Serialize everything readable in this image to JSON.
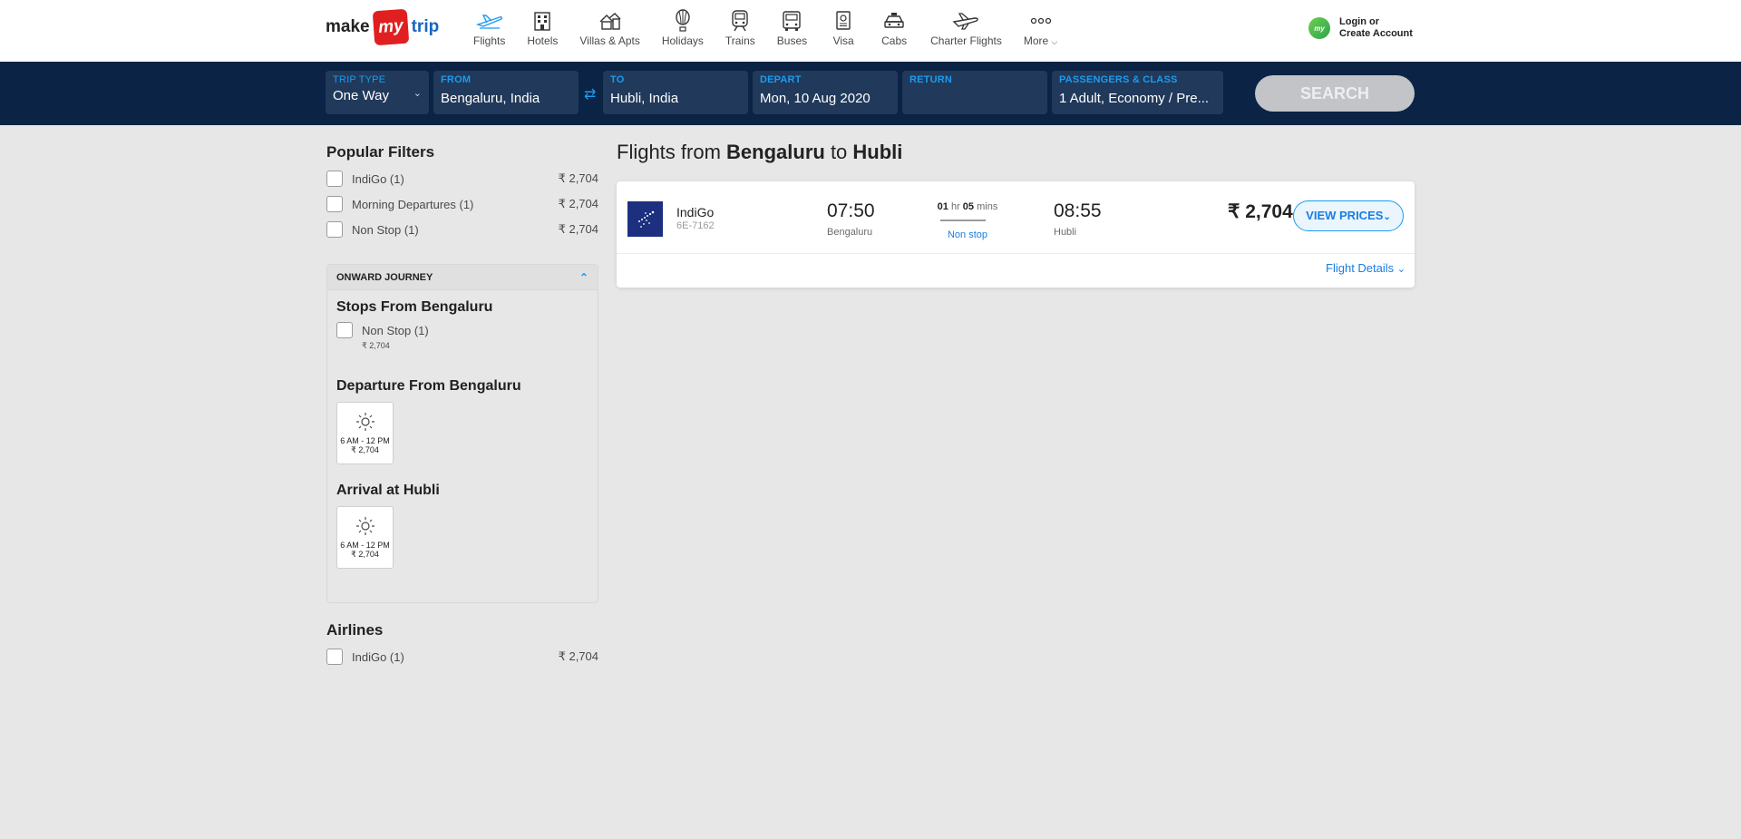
{
  "header": {
    "logo": {
      "make": "make",
      "my": "my",
      "trip": "trip"
    },
    "nav": [
      {
        "label": "Flights",
        "icon": "flight-icon"
      },
      {
        "label": "Hotels",
        "icon": "hotel-icon"
      },
      {
        "label": "Villas & Apts",
        "icon": "villa-icon"
      },
      {
        "label": "Holidays",
        "icon": "holiday-balloon-icon"
      },
      {
        "label": "Trains",
        "icon": "train-icon"
      },
      {
        "label": "Buses",
        "icon": "bus-icon"
      },
      {
        "label": "Visa",
        "icon": "passport-icon"
      },
      {
        "label": "Cabs",
        "icon": "cab-icon"
      },
      {
        "label": "Charter Flights",
        "icon": "charter-plane-icon"
      },
      {
        "label": "More",
        "icon": "more-dots-icon"
      }
    ],
    "login": {
      "line1": "Login or",
      "line2": "Create Account",
      "avatar": "my"
    }
  },
  "search": {
    "trip_type": {
      "label": "TRIP TYPE",
      "value": "One Way"
    },
    "from": {
      "label": "FROM",
      "value": "Bengaluru, India"
    },
    "to": {
      "label": "TO",
      "value": "Hubli, India"
    },
    "depart": {
      "label": "DEPART",
      "value": "Mon, 10 Aug 2020"
    },
    "return": {
      "label": "RETURN",
      "value": ""
    },
    "passengers": {
      "label": "PASSENGERS & CLASS",
      "value": "1 Adult, Economy / Pre..."
    },
    "button": "SEARCH"
  },
  "filters": {
    "popular": {
      "title": "Popular Filters",
      "items": [
        {
          "label": "IndiGo (1)",
          "price": "₹ 2,704"
        },
        {
          "label": "Morning Departures (1)",
          "price": "₹ 2,704"
        },
        {
          "label": "Non Stop (1)",
          "price": "₹ 2,704"
        }
      ]
    },
    "onward": {
      "title": "ONWARD JOURNEY",
      "stops_title": "Stops From Bengaluru",
      "stop": {
        "label": "Non Stop (1)",
        "price": "₹ 2,704"
      },
      "departure_title": "Departure From Bengaluru",
      "departure_slot": {
        "time": "6 AM - 12 PM",
        "price": "₹ 2,704"
      },
      "arrival_title": "Arrival at Hubli",
      "arrival_slot": {
        "time": "6 AM - 12 PM",
        "price": "₹ 2,704"
      }
    },
    "airlines": {
      "title": "Airlines",
      "items": [
        {
          "label": "IndiGo (1)",
          "price": "₹ 2,704"
        }
      ]
    }
  },
  "results": {
    "title": {
      "prefix": "Flights from ",
      "from": "Bengaluru",
      "mid": " to ",
      "to": "Hubli"
    },
    "flights": [
      {
        "airline": "IndiGo",
        "code": "6E-7162",
        "dep_time": "07:50",
        "dep_city": "Bengaluru",
        "duration": {
          "h": "01",
          "h_unit": "hr",
          "m": "05",
          "m_unit": "mins"
        },
        "stops": "Non stop",
        "arr_time": "08:55",
        "arr_city": "Hubli",
        "price": "₹ 2,704",
        "view_prices": "VIEW PRICES",
        "details": "Flight Details"
      }
    ]
  },
  "colors": {
    "accent": "#1a9cf0",
    "searchbar_bg": "#0b2445",
    "field_bg": "#21395a",
    "page_bg": "#e7e7e7",
    "indigo": "#1d2f7f"
  }
}
